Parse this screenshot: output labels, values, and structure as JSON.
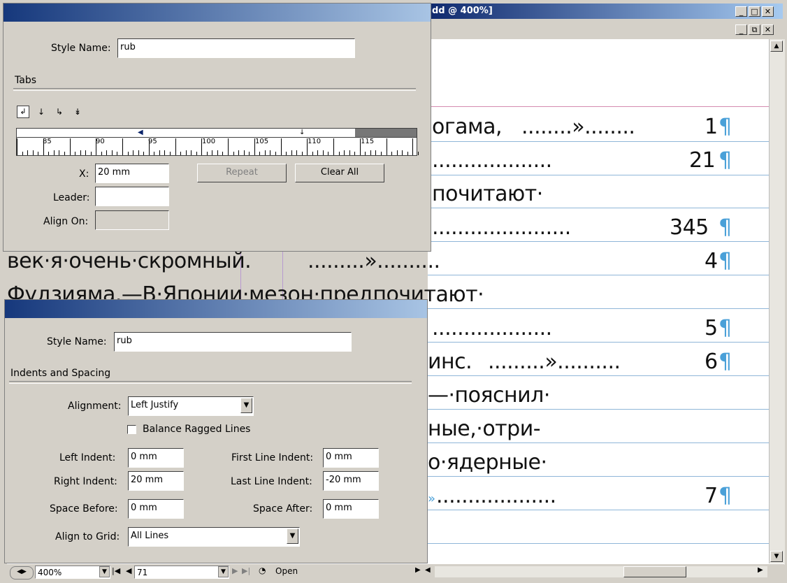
{
  "document_window": {
    "title": "dd @ 400%]",
    "text_lines": [
      {
        "text": "огама,",
        "leader": "........»........",
        "page": "1",
        "pilcrow": "¶"
      },
      {
        "text": "",
        "leader": "...................",
        "page": "21",
        "pilcrow": "¶"
      },
      {
        "text": "почитают·",
        "leader": "",
        "page": "",
        "pilcrow": ""
      },
      {
        "text": "",
        "leader": "......................",
        "page": "345",
        "pilcrow": "¶"
      },
      {
        "text": "век·я·очень·скромный.",
        "leader": ".........»..........",
        "page": "4",
        "pilcrow": "¶"
      },
      {
        "text": "Фудзияма.—В·Японии·мезон·предпочитают·",
        "leader": "",
        "page": "",
        "pilcrow": ""
      },
      {
        "text": "",
        "leader": "...................",
        "page": "5",
        "pilcrow": "¶"
      },
      {
        "text": "инс.",
        "leader": ".........»..........",
        "page": "6",
        "pilcrow": "¶"
      },
      {
        "text": "—·пояснил·",
        "leader": "",
        "page": "",
        "pilcrow": ""
      },
      {
        "text": "ные,·отри-",
        "leader": "",
        "page": "",
        "pilcrow": ""
      },
      {
        "text": "о·ядерные·",
        "leader": "",
        "page": "",
        "pilcrow": ""
      },
      {
        "text": "»",
        "leader": "...................",
        "page": "7",
        "pilcrow": "¶"
      }
    ]
  },
  "status_bar": {
    "zoom": "400%",
    "page": "71",
    "open_label": "Open"
  },
  "tabs_dialog": {
    "style_name_label": "Style Name:",
    "style_name_value": "rub",
    "section_label": "Tabs",
    "ruler_numbers": [
      "85",
      "90",
      "95",
      "100",
      "105",
      "110",
      "115"
    ],
    "x_label": "X:",
    "x_value": "20 mm",
    "leader_label": "Leader:",
    "leader_value": "",
    "align_on_label": "Align On:",
    "align_on_value": "",
    "repeat_label": "Repeat",
    "clear_all_label": "Clear All",
    "tab_type_icons": [
      "left-tab-icon",
      "center-tab-icon",
      "right-tab-icon",
      "decimal-tab-icon"
    ]
  },
  "indents_dialog": {
    "style_name_label": "Style Name:",
    "style_name_value": "rub",
    "section_label": "Indents and Spacing",
    "alignment_label": "Alignment:",
    "alignment_value": "Left Justify",
    "balance_label": "Balance Ragged Lines",
    "balance_checked": false,
    "left_indent_label": "Left Indent:",
    "left_indent_value": "0 mm",
    "first_line_indent_label": "First Line Indent:",
    "first_line_indent_value": "0 mm",
    "right_indent_label": "Right Indent:",
    "right_indent_value": "20 mm",
    "last_line_indent_label": "Last Line Indent:",
    "last_line_indent_value": "-20 mm",
    "space_before_label": "Space Before:",
    "space_before_value": "0 mm",
    "space_after_label": "Space After:",
    "space_after_value": "0 mm",
    "align_grid_label": "Align to Grid:",
    "align_grid_value": "All Lines"
  },
  "colors": {
    "title_bar_start": "#0a246a",
    "title_bar_end": "#a6caf0",
    "baseline_grid": "#8fb6d8",
    "margin_guide": "#d58ab0",
    "pilcrow": "#4aa0d8"
  }
}
